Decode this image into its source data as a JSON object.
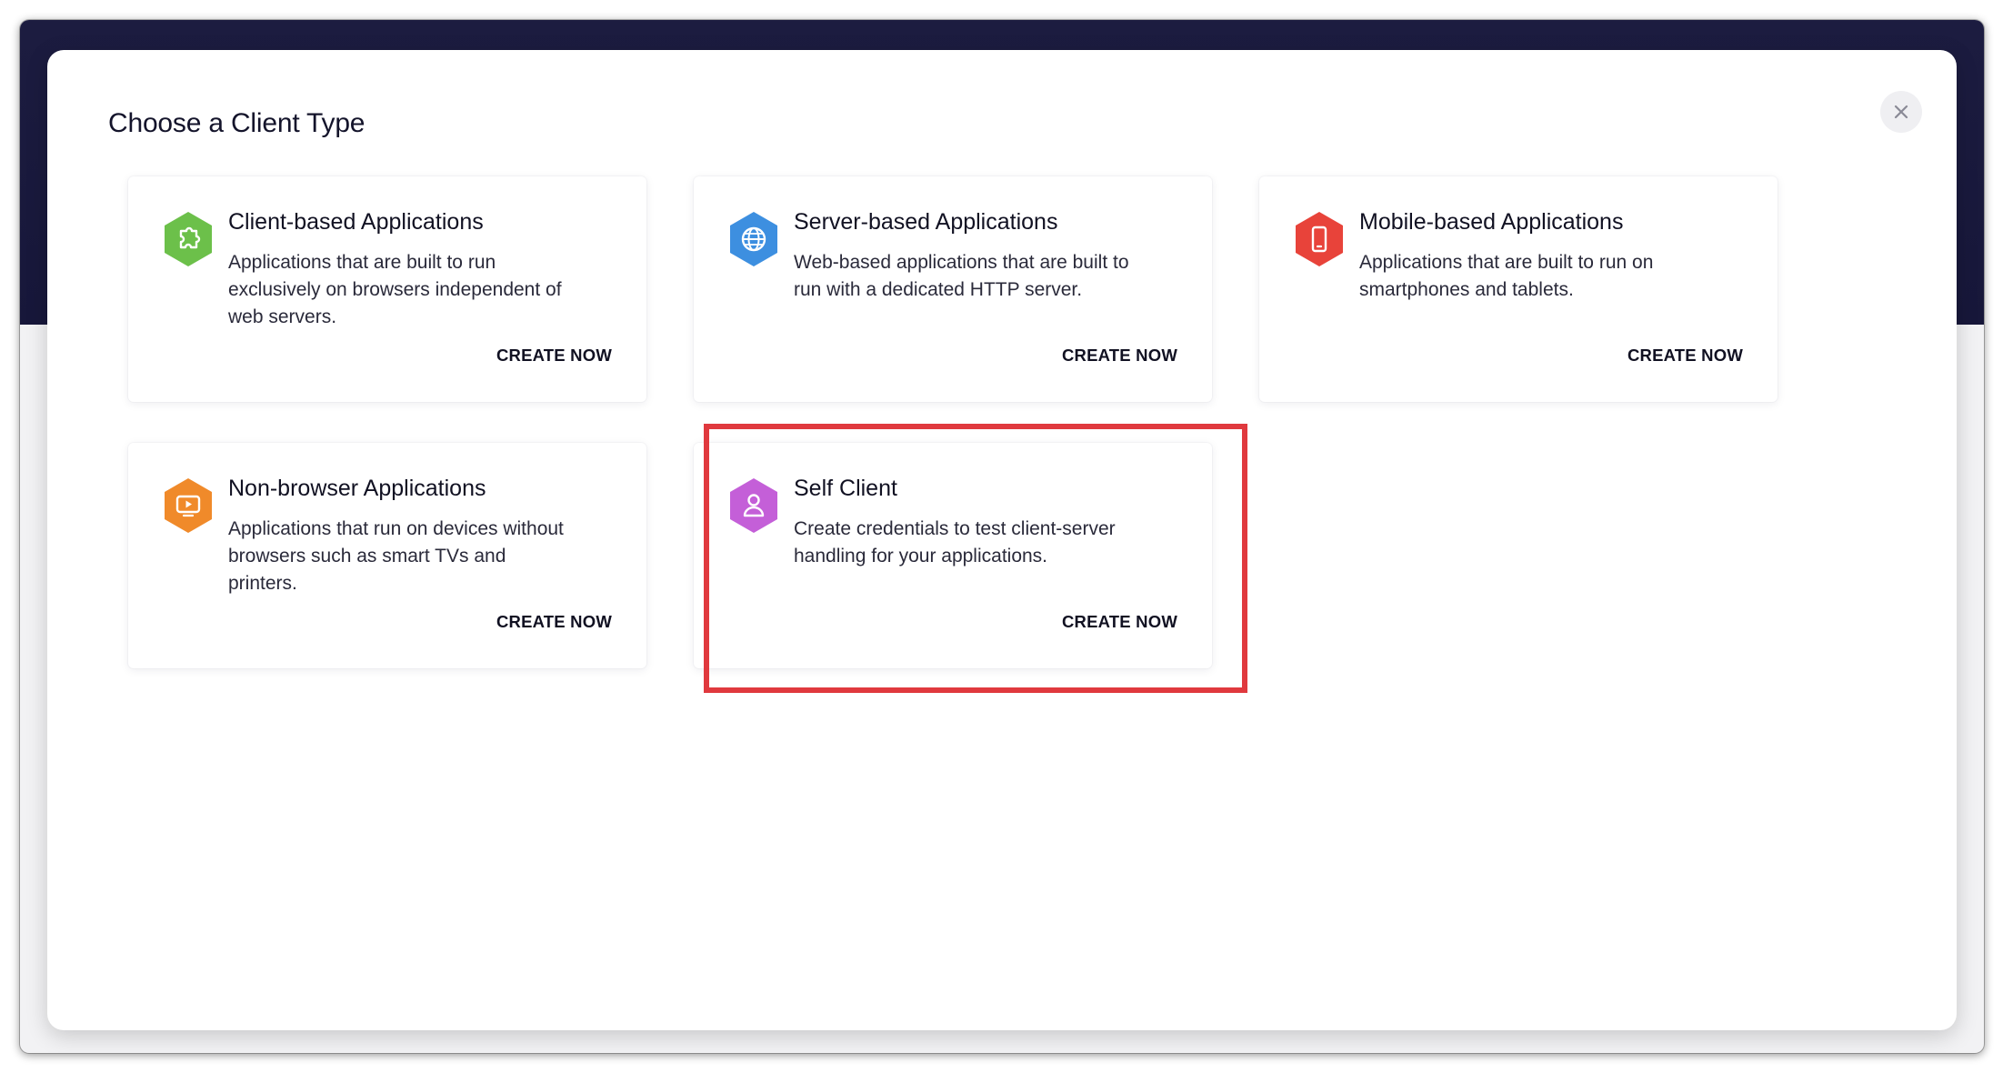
{
  "modal": {
    "title": "Choose a Client Type",
    "close_icon": "close-icon"
  },
  "cards": [
    {
      "title": "Client-based Applications",
      "description": "Applications that are built to run exclusively on browsers independent of web servers.",
      "action": "CREATE NOW",
      "icon": "puzzle-icon",
      "color": "#6cc04a"
    },
    {
      "title": "Server-based Applications",
      "description": "Web-based applications that are built to run with a dedicated HTTP server.",
      "action": "CREATE NOW",
      "icon": "globe-icon",
      "color": "#3d8fe0"
    },
    {
      "title": "Mobile-based Applications",
      "description": "Applications that are built to run on smartphones and tablets.",
      "action": "CREATE NOW",
      "icon": "phone-icon",
      "color": "#e8433a"
    },
    {
      "title": "Non-browser Applications",
      "description": "Applications that run on devices without browsers such as smart TVs and printers.",
      "action": "CREATE NOW",
      "icon": "tv-icon",
      "color": "#f08a2a"
    },
    {
      "title": "Self Client",
      "description": "Create credentials to test client-server handling for your applications.",
      "action": "CREATE NOW",
      "icon": "user-icon",
      "color": "#c45fd8"
    }
  ],
  "highlight": {
    "color": "#e0393e",
    "target": "Self Client"
  }
}
